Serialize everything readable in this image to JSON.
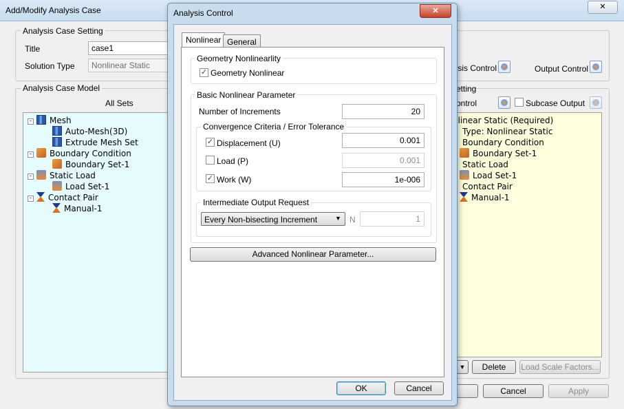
{
  "main": {
    "title": "Add/Modify Analysis Case",
    "close_glyph": "✕",
    "setting": {
      "group_label": "Analysis Case Setting",
      "title_label": "Title",
      "title_value": "case1",
      "solution_label": "Solution Type",
      "solution_value": "Nonlinear Static",
      "analysis_control_label": "Analysis Control",
      "output_control_label": "Output Control"
    },
    "model": {
      "group_label": "Analysis Case Model",
      "header": "All Sets",
      "tree": [
        {
          "label": "Mesh",
          "icon": "mesh-icon",
          "level": 0
        },
        {
          "label": "Auto-Mesh(3D)",
          "icon": "mesh-icon",
          "level": 1
        },
        {
          "label": "Extrude Mesh Set",
          "icon": "mesh-icon",
          "level": 1
        },
        {
          "label": "Boundary Condition",
          "icon": "boundary-icon",
          "level": 0
        },
        {
          "label": "Boundary Set-1",
          "icon": "boundary-icon",
          "level": 1
        },
        {
          "label": "Static Load",
          "icon": "load-icon",
          "level": 0
        },
        {
          "label": "Load Set-1",
          "icon": "load-icon",
          "level": 1
        },
        {
          "label": "Contact Pair",
          "icon": "contact-icon",
          "level": 0
        },
        {
          "label": "Manual-1",
          "icon": "contact-icon",
          "level": 1
        }
      ]
    },
    "right": {
      "group_label": "etting",
      "control_label": "ontrol",
      "subcase_label": "Subcase Output",
      "tree": [
        {
          "label": "nlinear Static (Required)",
          "icon": "",
          "level": 0
        },
        {
          "label": "Type: Nonlinear Static",
          "icon": "",
          "level": 1
        },
        {
          "label": "Boundary Condition",
          "icon": "",
          "level": 1
        },
        {
          "label": "Boundary Set-1",
          "icon": "boundary-icon",
          "level": 2
        },
        {
          "label": "Static Load",
          "icon": "",
          "level": 1
        },
        {
          "label": "Load Set-1",
          "icon": "load-icon",
          "level": 2
        },
        {
          "label": "Contact Pair",
          "icon": "",
          "level": 1
        },
        {
          "label": "Manual-1",
          "icon": "contact-icon",
          "level": 2
        }
      ],
      "delete_label": "Delete",
      "load_scale_label": "Load Scale Factors...",
      "down_glyph": "▼"
    },
    "cancel_label": "Cancel",
    "apply_label": "Apply"
  },
  "dialog": {
    "title": "Analysis Control",
    "close_glyph": "✕",
    "tabs": [
      {
        "label": "Nonlinear",
        "active": true
      },
      {
        "label": "General",
        "active": false
      }
    ],
    "geometry": {
      "group_label": "Geometry Nonlinearlity",
      "checkbox_label": "Geometry Nonlinear",
      "checked": true
    },
    "basic": {
      "group_label": "Basic Nonlinear Parameter",
      "increments_label": "Number of Increments",
      "increments_value": "20",
      "convergence_label": "Convergence Criteria / Error Tolerance",
      "criteria": [
        {
          "label": "Displacement (U)",
          "checked": true,
          "value": "0.001",
          "enabled": true
        },
        {
          "label": "Load (P)",
          "checked": false,
          "value": "0.001",
          "enabled": false
        },
        {
          "label": "Work (W)",
          "checked": true,
          "value": "1e-006",
          "enabled": true
        }
      ],
      "output_label": "Intermediate Output Request",
      "output_select": "Every Non-bisecting Increment",
      "n_label": "N",
      "n_value": "1"
    },
    "advanced_label": "Advanced Nonlinear Parameter...",
    "ok_label": "OK",
    "cancel_label": "Cancel",
    "check_glyph": "✓",
    "dropdown_glyph": "▼"
  }
}
